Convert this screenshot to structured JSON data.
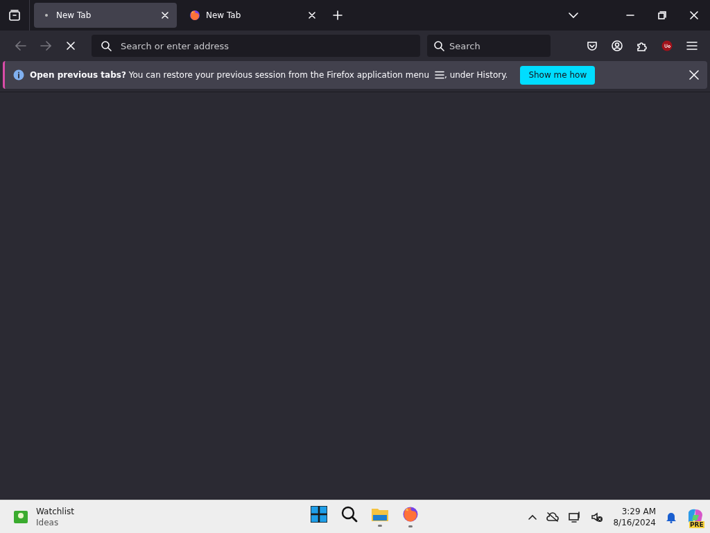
{
  "tabs": [
    {
      "label": "New Tab",
      "kind": "dot",
      "selected": true
    },
    {
      "label": "New Tab",
      "kind": "logo",
      "selected": false
    }
  ],
  "toolbar": {
    "address_placeholder": "Search or enter address",
    "search_placeholder": "Search"
  },
  "notice": {
    "message": "**Open previous tabs?** You can restore your previous session from the Firefox application menu",
    "message_end": ", under History.",
    "button": "Show me how"
  },
  "taskbar": {
    "widget_title": "Watchlist",
    "widget_subtitle": "Ideas",
    "apps": [
      {
        "kind": "start",
        "running": false
      },
      {
        "kind": "search",
        "running": false
      },
      {
        "kind": "folder",
        "running": true
      },
      {
        "kind": "browser",
        "running": true
      }
    ],
    "time": "3:29 AM",
    "date": "8/16/2024",
    "copilot_badge": "PRE"
  }
}
